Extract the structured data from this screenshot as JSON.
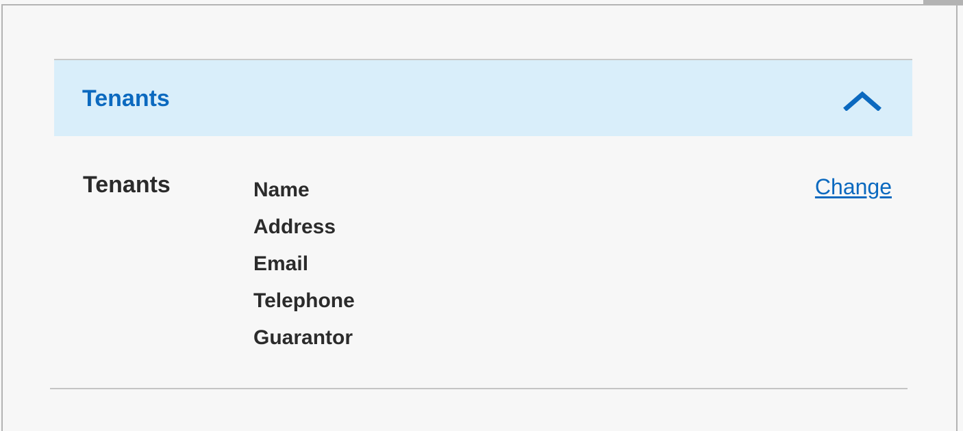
{
  "accordion": {
    "title": "Tenants",
    "expanded": true,
    "toggle_icon": "chevron-up-icon",
    "header_bg": "#d9eefa",
    "accent": "#0b69bf"
  },
  "summary": {
    "label": "Tenants",
    "fields": [
      "Name",
      "Address",
      "Email",
      "Telephone",
      "Guarantor"
    ],
    "change_label": "Change"
  }
}
